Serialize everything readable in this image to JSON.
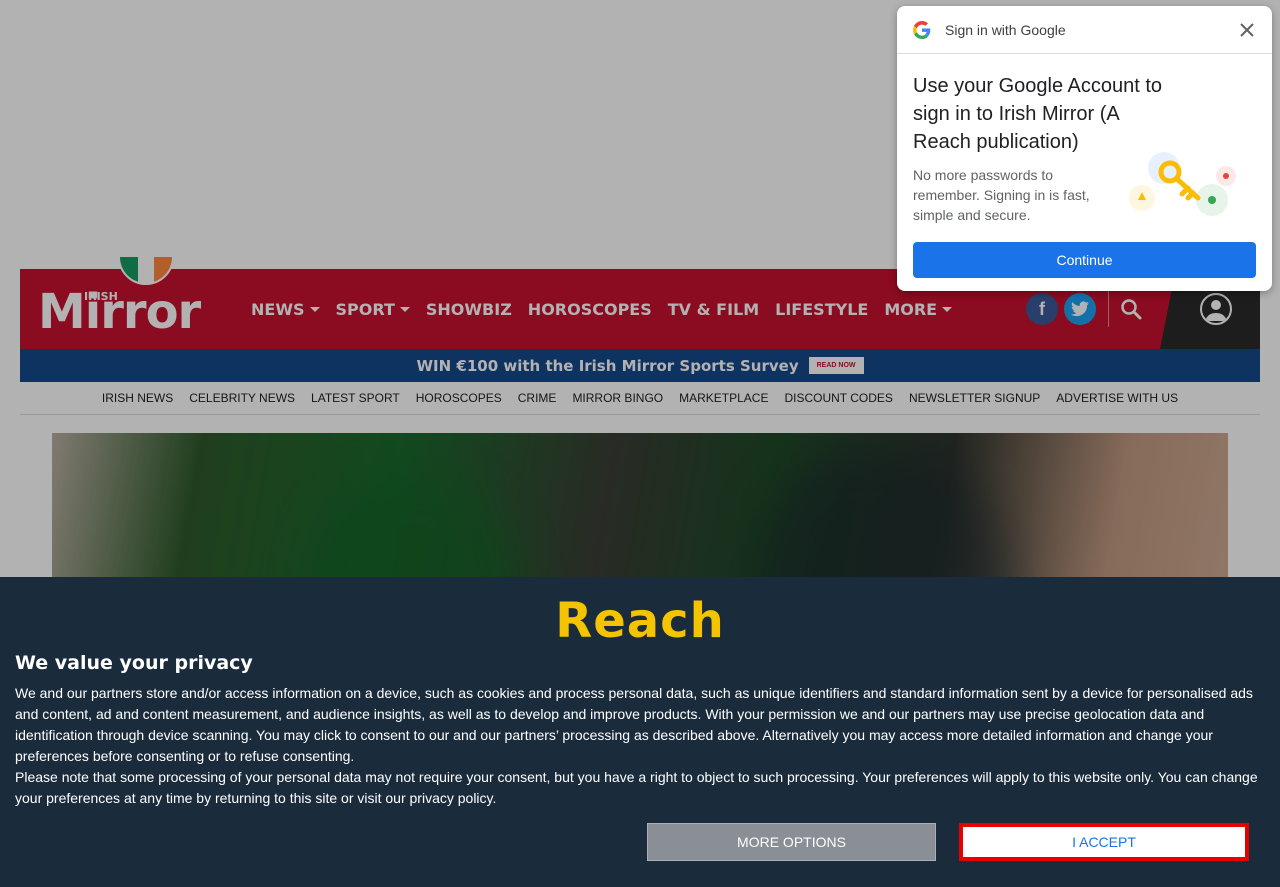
{
  "masthead": {
    "logo_small": "IRISH",
    "logo_big": "Mirror",
    "nav": [
      {
        "label": "NEWS",
        "dropdown": true
      },
      {
        "label": "SPORT",
        "dropdown": true
      },
      {
        "label": "SHOWBIZ",
        "dropdown": false
      },
      {
        "label": "HOROSCOPES",
        "dropdown": false
      },
      {
        "label": "TV & FILM",
        "dropdown": false
      },
      {
        "label": "LIFESTYLE",
        "dropdown": false
      },
      {
        "label": "MORE",
        "dropdown": true
      }
    ],
    "facebook_glyph": "f",
    "brand_color": "#c8102e"
  },
  "promo": {
    "text": "WIN €100 with the Irish Mirror Sports Survey",
    "button": "READ NOW"
  },
  "subnav": [
    "IRISH NEWS",
    "CELEBRITY NEWS",
    "LATEST SPORT",
    "HOROSCOPES",
    "CRIME",
    "MIRROR BINGO",
    "MARKETPLACE",
    "DISCOUNT CODES",
    "NEWSLETTER SIGNUP",
    "ADVERTISE WITH US"
  ],
  "google_signin": {
    "header": "Sign in with Google",
    "title": "Use your Google Account to sign in to Irish Mirror (A Reach publication)",
    "description": "No more passwords to remember. Signing in is fast, simple and secure.",
    "continue_label": "Continue"
  },
  "consent": {
    "logo": "Reach",
    "title": "We value your privacy",
    "paragraph1": "We and our partners store and/or access information on a device, such as cookies and process personal data, such as unique identifiers and standard information sent by a device for personalised ads and content, ad and content measurement, and audience insights, as well as to develop and improve products. With your permission we and our partners may use precise geolocation data and identification through device scanning. You may click to consent to our and our partners’ processing as described above. Alternatively you may access more detailed information and change your preferences before consenting or to refuse consenting.",
    "paragraph2": "Please note that some processing of your personal data may not require your consent, but you have a right to object to such processing. Your preferences will apply to this website only. You can change your preferences at any time by returning to this site or visit our privacy policy.",
    "more_options": "MORE OPTIONS",
    "accept": "I ACCEPT",
    "accent_color": "#f5c400"
  }
}
